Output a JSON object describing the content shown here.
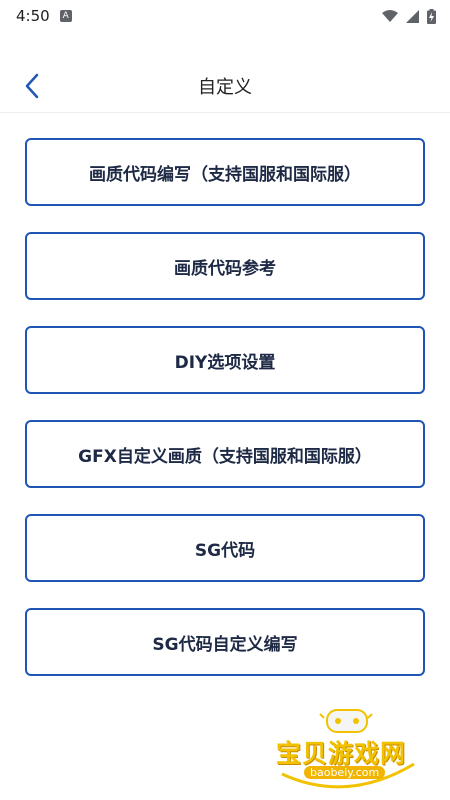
{
  "status_bar": {
    "time": "4:50",
    "notification_glyph": "A"
  },
  "header": {
    "title": "自定义"
  },
  "menu": [
    {
      "label": "画质代码编写（支持国服和国际服）"
    },
    {
      "label": "画质代码参考"
    },
    {
      "label": "DIY选项设置"
    },
    {
      "label": "GFX自定义画质（支持国服和国际服）"
    },
    {
      "label": "SG代码"
    },
    {
      "label": "SG代码自定义编写"
    }
  ],
  "watermark": {
    "title": "宝贝游戏网",
    "url": "baobeiy.com"
  },
  "colors": {
    "accent": "#1f56b3",
    "text": "#1e2a45",
    "watermark": "#f2c200"
  }
}
